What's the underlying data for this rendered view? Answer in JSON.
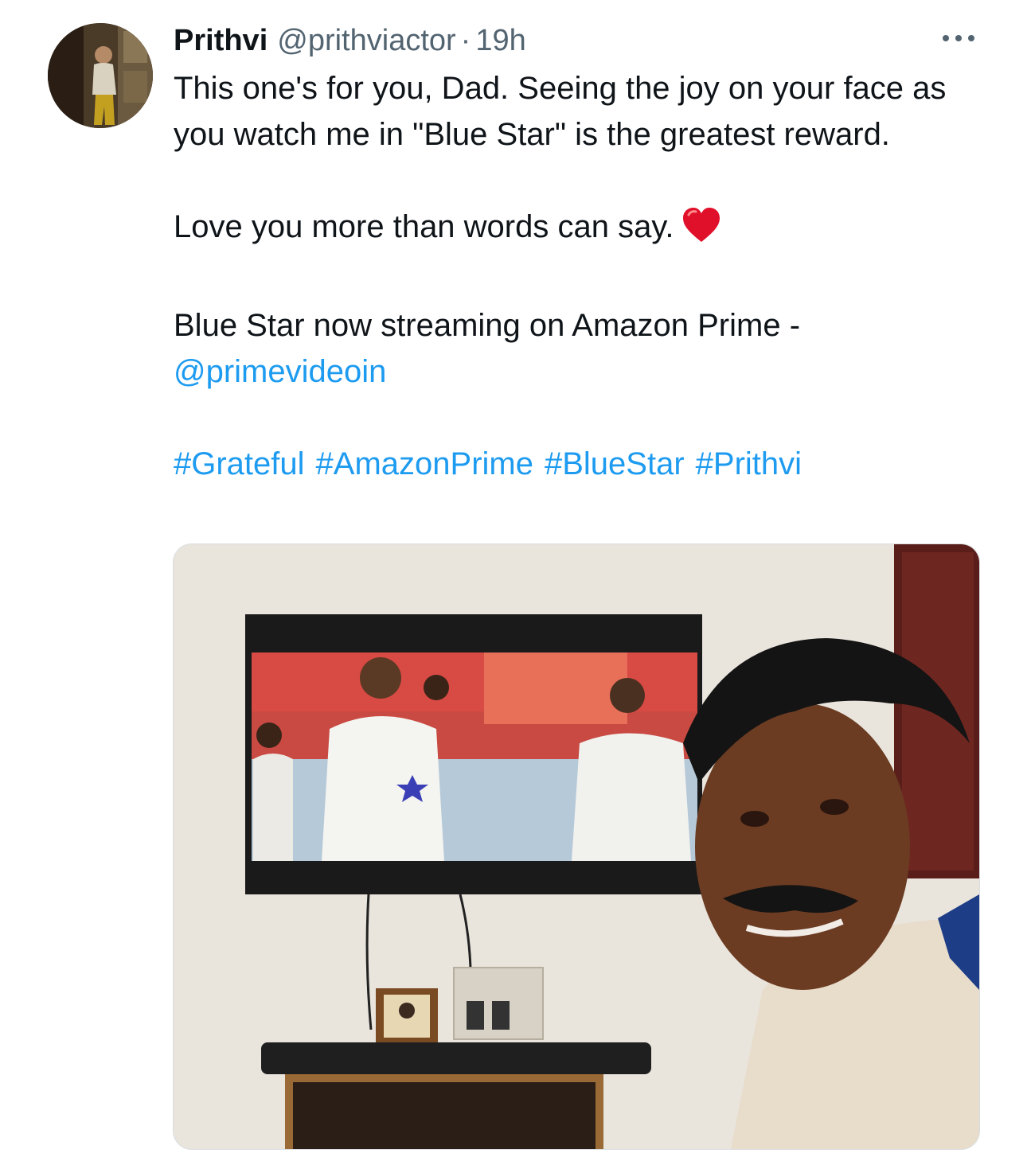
{
  "tweet": {
    "author_name": "Prithvi",
    "author_handle": "@prithviactor",
    "separator": "·",
    "time": "19h",
    "text_line_1": "This one's for you, Dad. Seeing the joy on your face as you watch me in \"Blue Star\" is the greatest reward.",
    "text_line_2": "Love you more than words can say.",
    "text_line_3": "Blue Star now streaming on Amazon Prime -",
    "mention": "@primevideoin",
    "hashtags": [
      "#Grateful",
      "#AmazonPrime",
      "#BlueStar",
      "#Prithvi"
    ]
  },
  "icons": {
    "more": "more-horizontal-icon",
    "heart": "red-heart-emoji"
  },
  "colors": {
    "link": "#1d9bf0",
    "secondary_text": "#536471",
    "primary_text": "#0f1419",
    "heart": "#e0102b"
  }
}
